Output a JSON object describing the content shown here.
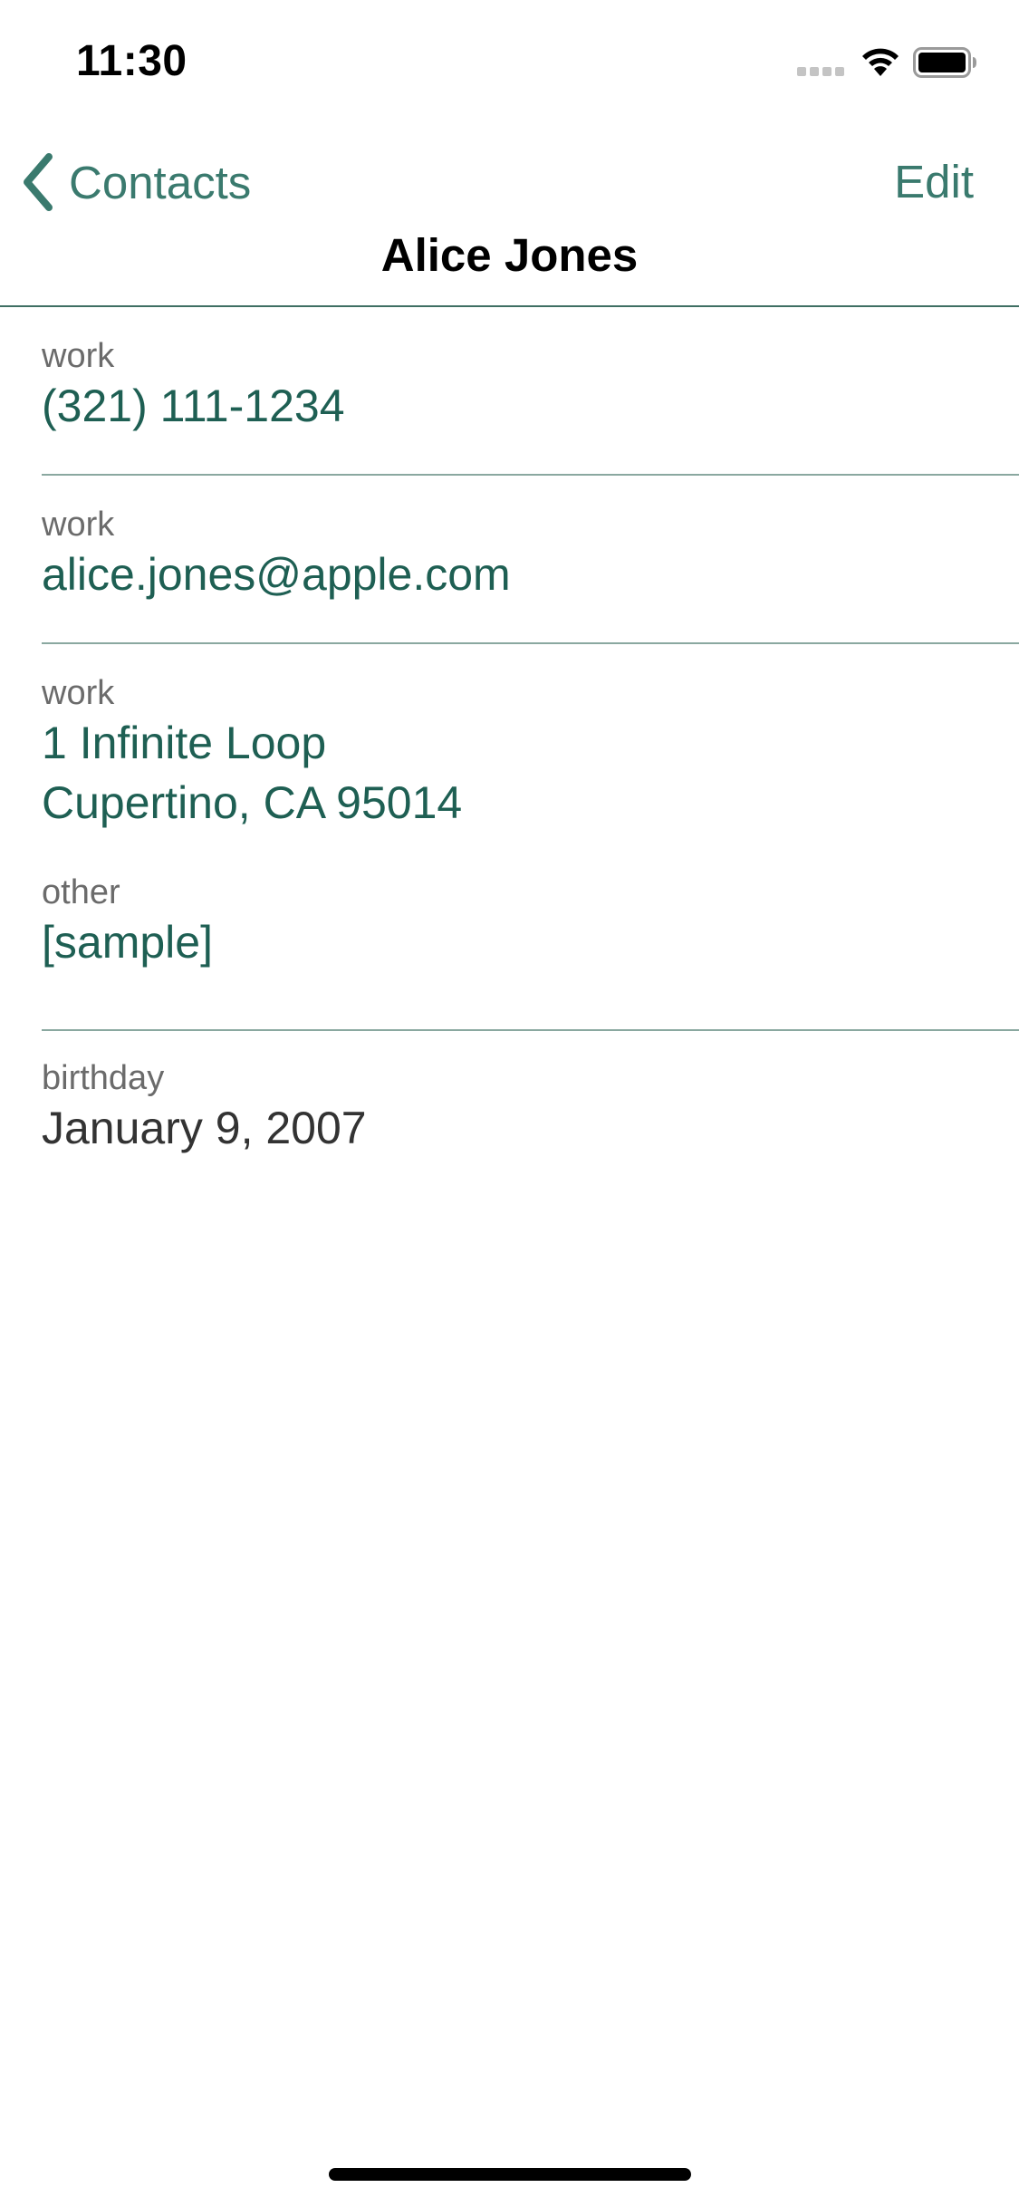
{
  "status_bar": {
    "time": "11:30"
  },
  "nav": {
    "back_label": "Contacts",
    "edit_label": "Edit",
    "title": "Alice Jones"
  },
  "details": {
    "phone": {
      "label": "work",
      "value": "(321) 111-1234"
    },
    "email": {
      "label": "work",
      "value": "alice.jones@apple.com"
    },
    "address": {
      "label": "work",
      "line1": "1 Infinite Loop",
      "line2": "Cupertino, CA 95014"
    },
    "other": {
      "label": "other",
      "value": "[sample]"
    },
    "birthday": {
      "label": "birthday",
      "value": "January 9, 2007"
    }
  },
  "theme": {
    "accent": "#3a7a6e",
    "value_color": "#1e5f53",
    "divider": "#3f6f63"
  },
  "icons": {
    "back": "chevron-left-icon",
    "signal": "cellular-signal-icon",
    "wifi": "wifi-icon",
    "battery": "battery-icon"
  }
}
